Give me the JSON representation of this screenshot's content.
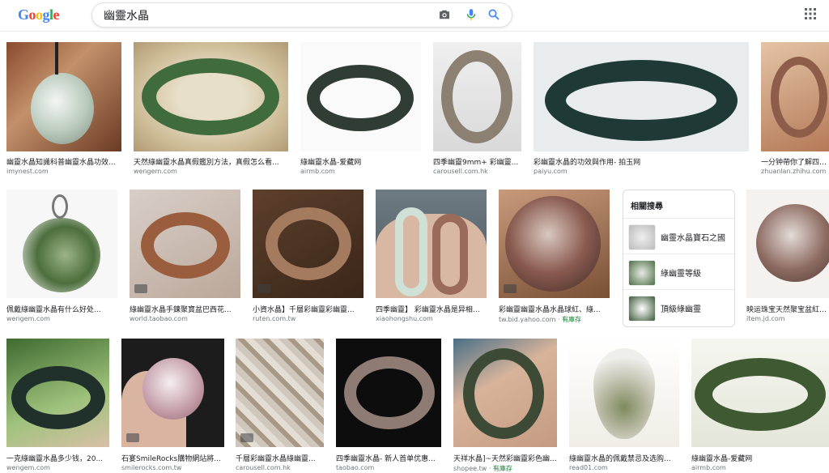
{
  "header": {
    "logo_text": "Google",
    "query": "幽靈水晶",
    "icons": [
      "camera-icon",
      "microphone-icon",
      "search-icon",
      "apps-grid-icon"
    ]
  },
  "results": [
    {
      "caption": "幽靈水晶知識科普幽靈水晶功效...",
      "source": "imynest.com"
    },
    {
      "caption": "天然綠幽靈水晶真假鑑別方法，真假怎么看...",
      "source": "wengem.com"
    },
    {
      "caption": "綠幽靈水晶-爱藏网",
      "source": "airmb.com"
    },
    {
      "caption": "四季幽靈9mm+ 彩幽靈...",
      "source": "carousell.com.hk"
    },
    {
      "caption": "彩幽靈水晶的功效與作用- 拍玉网",
      "source": "paiyu.com"
    },
    {
      "caption": "一分钟帶你了解四季...",
      "source": "zhuanlan.zhihu.com"
    },
    {
      "caption": "佩戴綠幽靈水晶有什么好处...",
      "source": "wengem.com"
    },
    {
      "caption": "綠幽靈水晶手鍊聚寶盆巴西花...",
      "source": "world.taobao.com"
    },
    {
      "caption": "小資水晶】千層彩幽靈彩幽靈...",
      "source": "ruten.com.tw"
    },
    {
      "caption": "四季幽靈】 彩幽靈水晶是异相水...",
      "source": "xiaohongshu.com"
    },
    {
      "caption": "彩幽靈幽靈水晶水晶球紅、綠...",
      "source": "tw.bid.yahoo.com",
      "availability": "有庫存"
    },
    {
      "caption": "映运珠宝天然聚宝盆紅绿...",
      "source": "item.jd.com"
    },
    {
      "caption": "一克綠幽靈水晶多少钱，20...",
      "source": "wengem.com"
    },
    {
      "caption": "石宴SmileRocks購物網站將...",
      "source": "smilerocks.com.tw"
    },
    {
      "caption": "千層彩幽靈水晶綠幽靈...",
      "source": "carousell.com.hk"
    },
    {
      "caption": "四季幽靈水晶- 新人首单优惠...",
      "source": "taobao.com"
    },
    {
      "caption": "天祥水晶]~天然彩幽靈彩色幽...",
      "source": "shopee.tw",
      "availability": "有庫存"
    },
    {
      "caption": "綠幽靈水晶的佩戴禁忌及选购...",
      "source": "read01.com"
    },
    {
      "caption": "綠幽靈水晶-爱藏网",
      "source": "airmb.com"
    }
  ],
  "related": {
    "title": "相關搜尋",
    "items": [
      {
        "label": "幽靈水晶寶石之國"
      },
      {
        "label": "綠幽靈等級"
      },
      {
        "label": "頂級綠幽靈"
      }
    ]
  },
  "colors": {
    "link_gray": "#70757a",
    "available_green": "#188038",
    "search_blue": "#4285f4",
    "mic_red": "#ea4335"
  }
}
